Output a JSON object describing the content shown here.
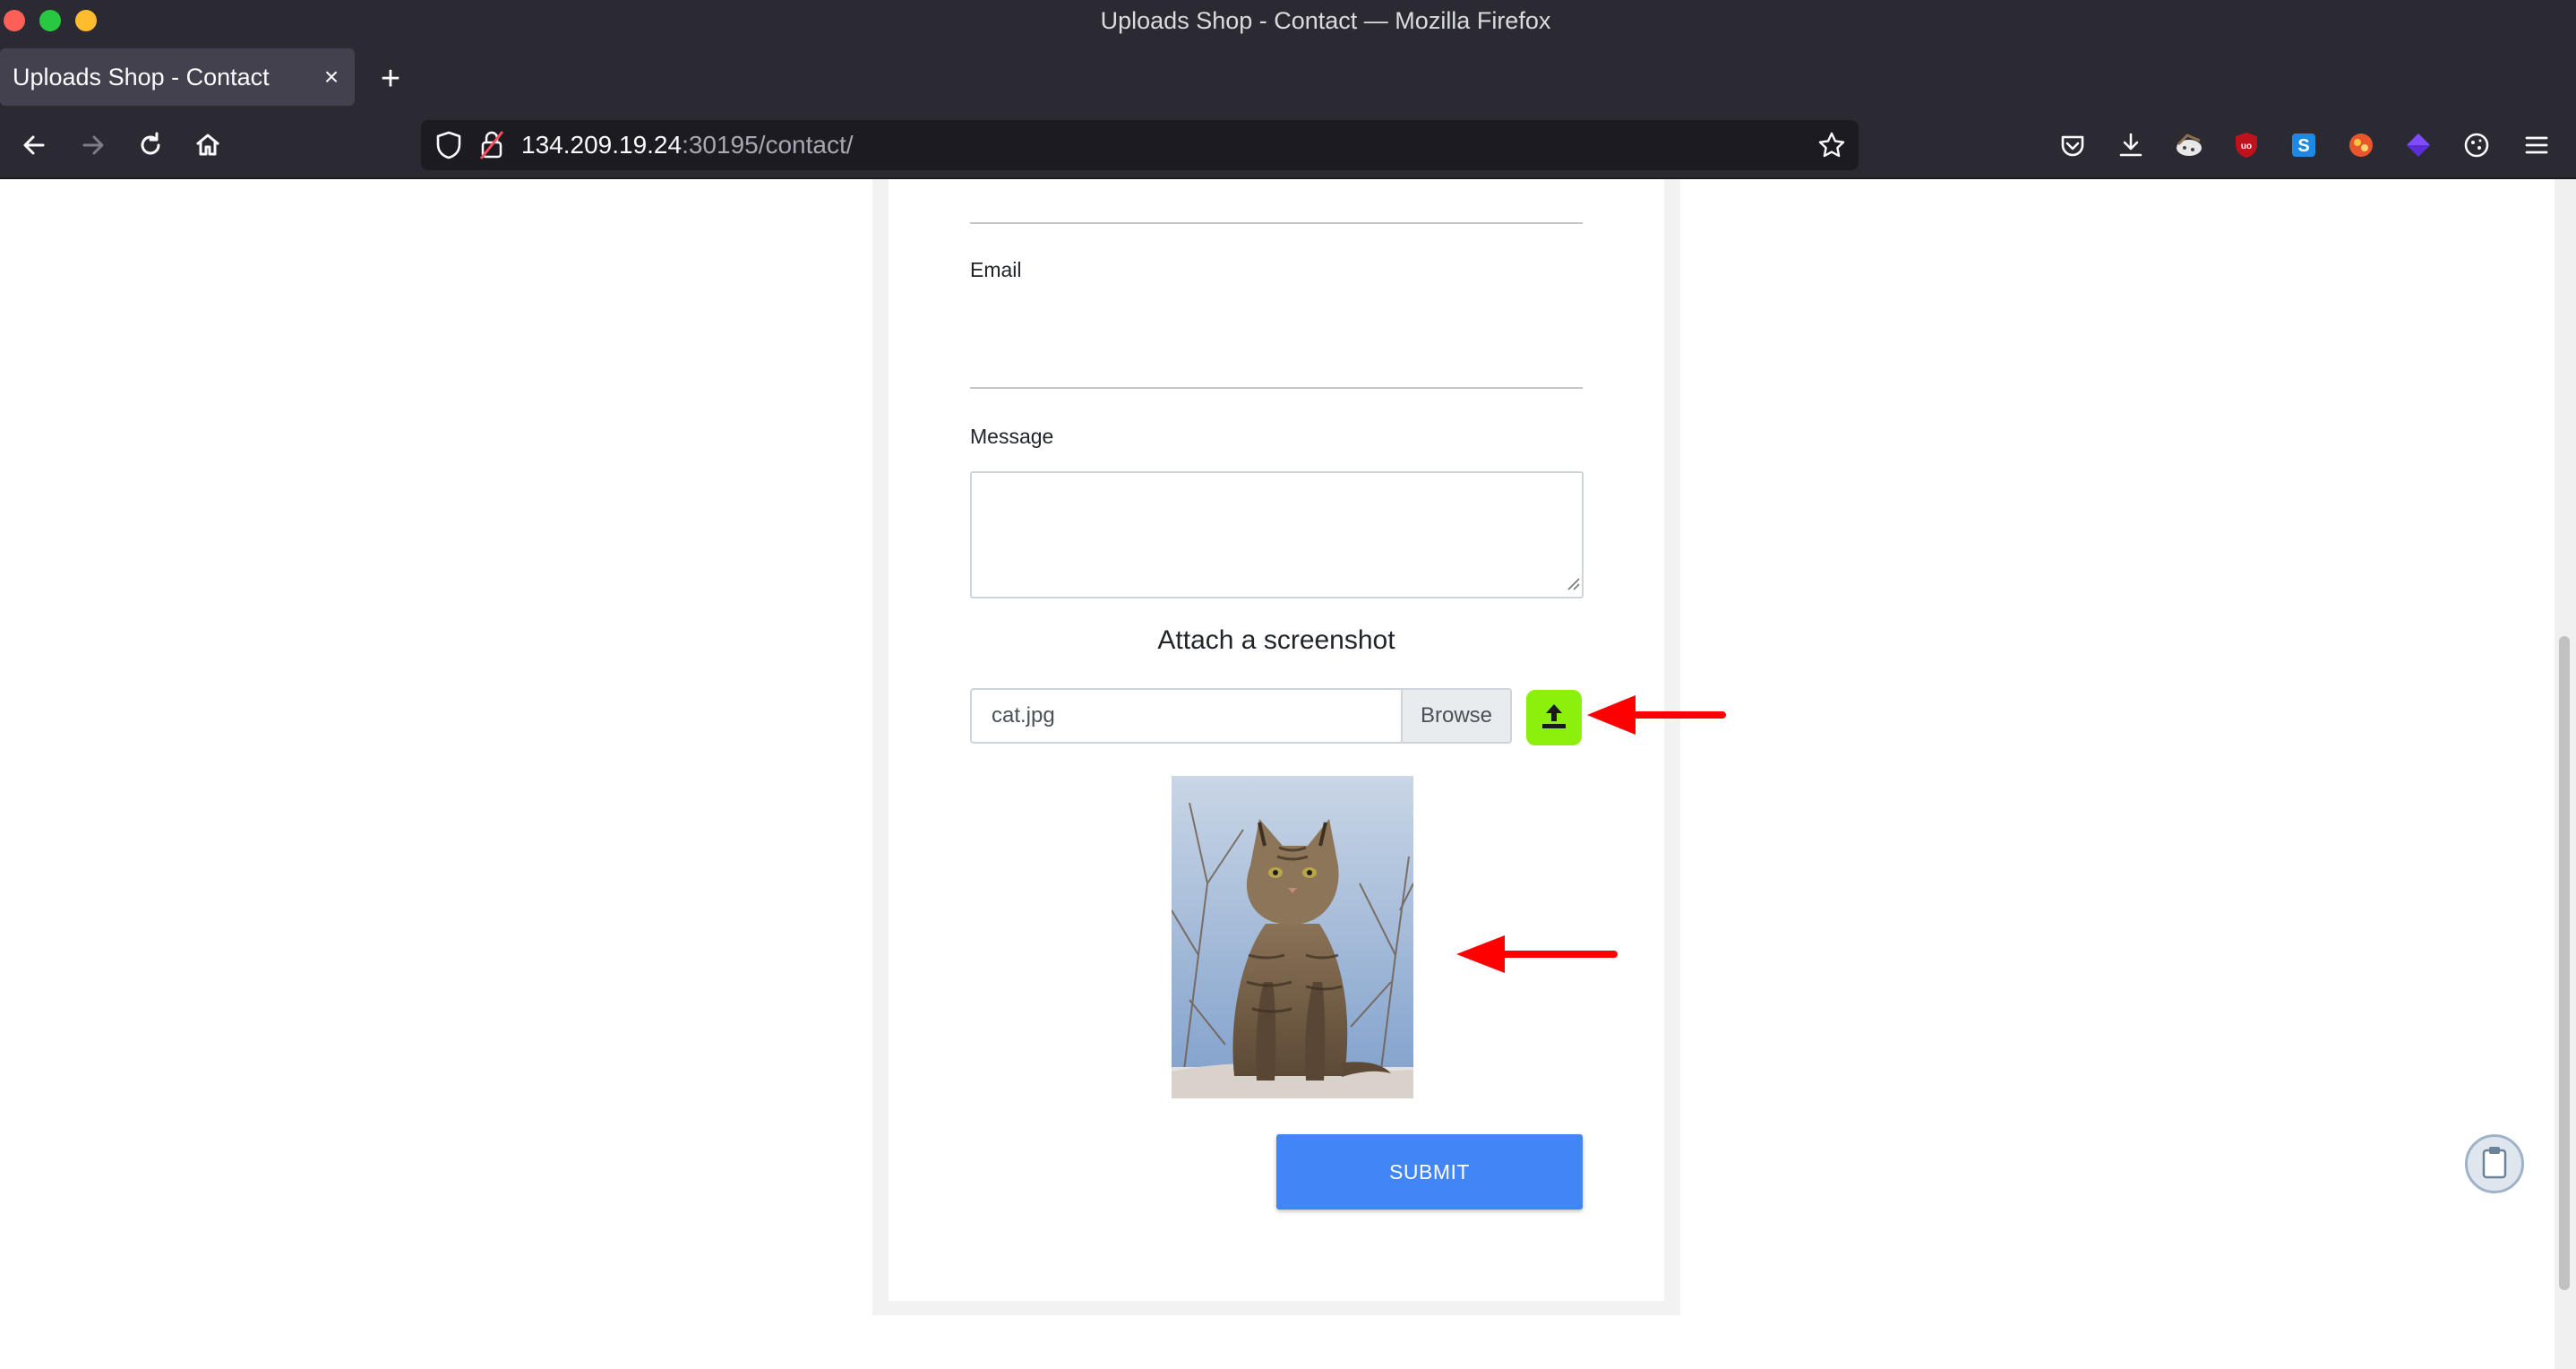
{
  "window": {
    "title": "Uploads Shop - Contact — Mozilla Firefox"
  },
  "tab": {
    "title": "Uploads Shop - Contact",
    "close": "×",
    "new_tab": "+"
  },
  "urlbar": {
    "host": "134.209.19.24",
    "rest": ":30195/contact/"
  },
  "form": {
    "email_label": "Email",
    "message_label": "Message",
    "message_value": "",
    "attach_title": "Attach a screenshot",
    "file_name": "cat.jpg",
    "browse_label": "Browse",
    "submit_label": "SUBMIT"
  },
  "colors": {
    "upload_button": "#8cf00d",
    "submit_button": "#4285f4",
    "annotation_arrow": "#ff0000"
  },
  "icons": [
    "back-icon",
    "forward-icon",
    "reload-icon",
    "home-icon",
    "shield-icon",
    "insecure-lock-icon",
    "bookmark-star-icon",
    "pocket-icon",
    "download-icon",
    "ublock-icon",
    "extension-icons",
    "menu-icon",
    "upload-icon",
    "clipboard-icon"
  ]
}
